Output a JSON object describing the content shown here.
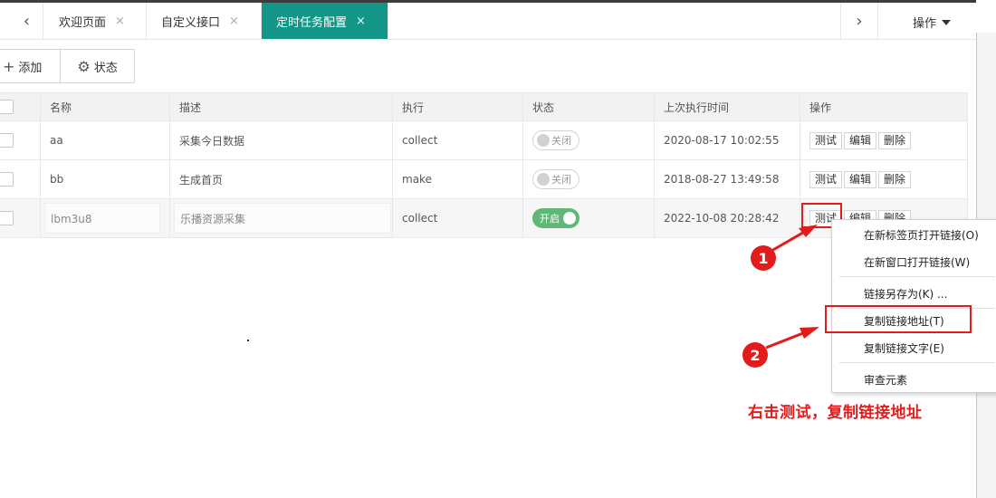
{
  "tabs": [
    {
      "label": "欢迎页面"
    },
    {
      "label": "自定义接口"
    },
    {
      "label": "定时任务配置"
    }
  ],
  "tab_close": "×",
  "nav": {
    "prev": "‹",
    "next": "›"
  },
  "operations_label": "操作",
  "toolbar": {
    "add_label": "添加",
    "status_label": "状态"
  },
  "table": {
    "headers": [
      "名称",
      "描述",
      "执行",
      "状态",
      "上次执行时间",
      "操作"
    ],
    "rows": [
      {
        "name": "aa",
        "desc": "采集今日数据",
        "exec": "collect",
        "status": "关闭",
        "last_run": "2020-08-17 10:02:55"
      },
      {
        "name": "bb",
        "desc": "生成首页",
        "exec": "make",
        "status": "关闭",
        "last_run": "2018-08-27 13:49:58"
      },
      {
        "name": "lbm3u8",
        "desc": "乐播资源采集",
        "exec": "collect",
        "status": "开启",
        "last_run": "2022-10-08 20:28:42"
      }
    ],
    "actions": {
      "test": "测试",
      "edit": "编辑",
      "delete": "删除"
    }
  },
  "context_menu": {
    "items": [
      "在新标签页打开链接(O)",
      "在新窗口打开链接(W)",
      "链接另存为(K) ...",
      "复制链接地址(T)",
      "复制链接文字(E)",
      "审查元素"
    ]
  },
  "annotations": {
    "badge1": "1",
    "badge2": "2",
    "caption": "右击测试，复制链接地址"
  },
  "colors": {
    "tab_active": "#139688",
    "switch_on": "#5fb878",
    "annotation": "#e21b1b"
  }
}
